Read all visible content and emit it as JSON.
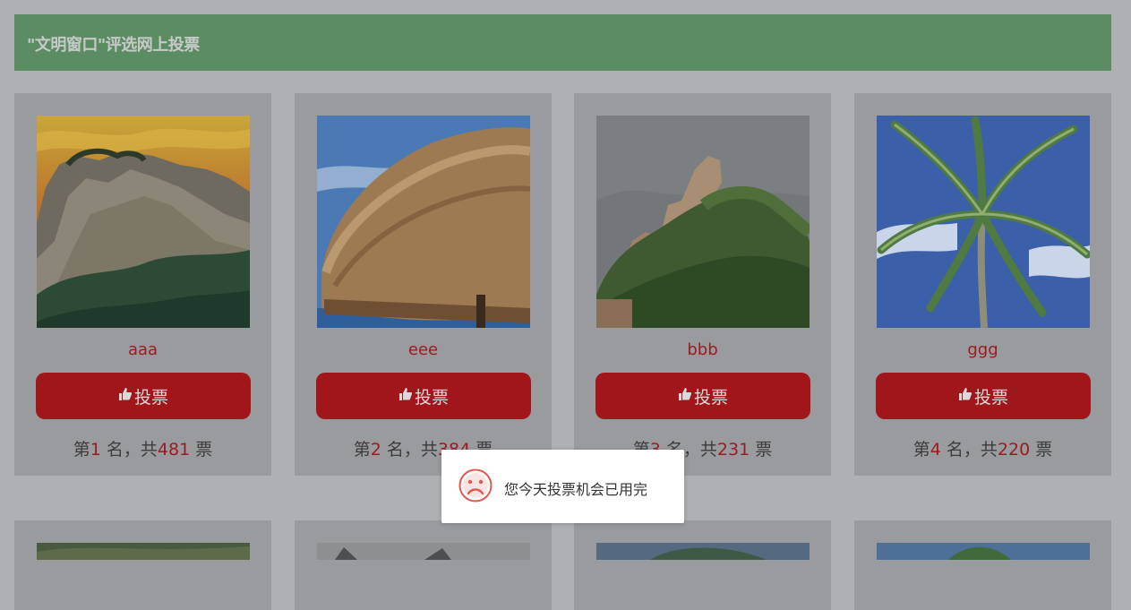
{
  "header": {
    "title": "\"文明窗口\"评选网上投票"
  },
  "vote_label": "投票",
  "rank_template": {
    "prefix": "第",
    "mid": " 名，共",
    "suffix": " 票"
  },
  "cards": [
    {
      "name": "aaa",
      "rank": "1",
      "votes": "481",
      "image": "rocky-mountain-sunset"
    },
    {
      "name": "eee",
      "rank": "2",
      "votes": "384",
      "image": "thatched-umbrella"
    },
    {
      "name": "bbb",
      "rank": "3",
      "votes": "231",
      "image": "rock-hill-forest"
    },
    {
      "name": "ggg",
      "rank": "4",
      "votes": "220",
      "image": "palm-tree"
    }
  ],
  "toast": {
    "message": "您今天投票机会已用完",
    "icon": "sad-face-icon"
  },
  "colors": {
    "overlay_bg": "#afb0b4",
    "header_bg": "#5c8c61",
    "card_bg": "#9a9b9f",
    "button_bg": "#a1161b",
    "accent_red": "#9b1b1f",
    "toast_icon": "#e0594f"
  }
}
